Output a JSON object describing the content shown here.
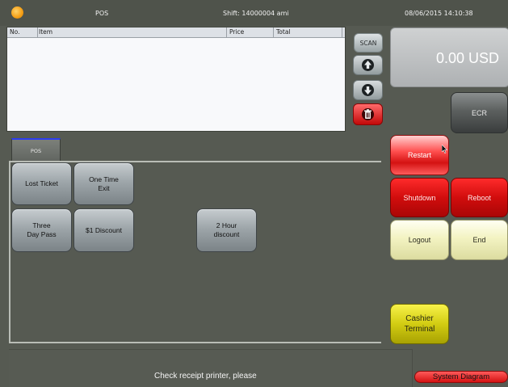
{
  "titlebar": {
    "app_title": "POS",
    "shift": "Shift: 14000004  ami",
    "datetime": "08/06/2015 14:10:38"
  },
  "order_table": {
    "columns": [
      "No.",
      "Item",
      "Price",
      "Total"
    ],
    "rows": []
  },
  "side_buttons": {
    "scan": "SCAN"
  },
  "total": {
    "amount": "0.00 USD"
  },
  "action_buttons": {
    "ecr": "ECR",
    "restart": "Restart",
    "shutdown": "Shutdown",
    "reboot": "Reboot",
    "logout": "Logout",
    "end": "End",
    "cashier_line1": "Cashier",
    "cashier_line2": "Terminal"
  },
  "tabs": [
    {
      "label": "POS",
      "active": true
    }
  ],
  "product_buttons": {
    "lost_ticket": "Lost Ticket",
    "one_time_line1": "One Time",
    "one_time_line2": "Exit",
    "three_day_line1": "Three",
    "three_day_line2": "Day Pass",
    "one_discount": "$1 Discount",
    "two_hour_line1": "2 Hour",
    "two_hour_line2": "discount"
  },
  "status": {
    "message": "Check receipt printer, please",
    "system_diagram": "System Diagram"
  },
  "icons": {
    "logo": "sun-logo-icon",
    "up": "arrow-up-icon",
    "down": "arrow-down-icon",
    "trash": "trash-icon"
  },
  "colors": {
    "background": "#565a52",
    "danger_red": "#d41212",
    "light_yellow": "#f3f3c2",
    "cashier_yellow": "#d2cc12"
  }
}
